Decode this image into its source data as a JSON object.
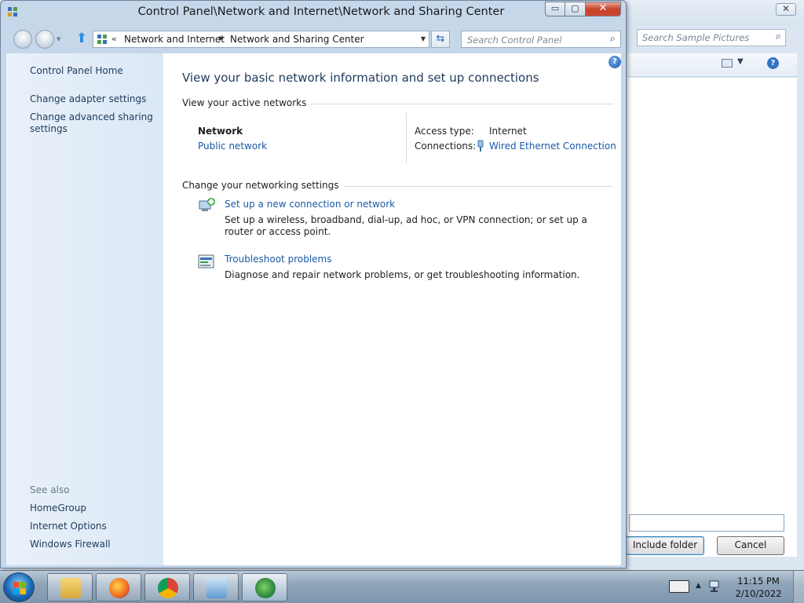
{
  "background_window": {
    "search_placeholder": "Search Sample Pictures",
    "include_button": "Include folder",
    "cancel_button": "Cancel",
    "close_label": "✕"
  },
  "window": {
    "title": "Control Panel\\Network and Internet\\Network and Sharing Center",
    "minimize": "▭",
    "maximize": "▢",
    "close": "✕"
  },
  "address_bar": {
    "chevron": "«",
    "crumbs": [
      "Network and Internet",
      "Network and Sharing Center"
    ],
    "separator": "▶",
    "dropdown": "▼"
  },
  "search": {
    "placeholder": "Search Control Panel"
  },
  "sidebar": {
    "home": "Control Panel Home",
    "items": [
      "Change adapter settings",
      "Change advanced sharing settings"
    ],
    "see_also_label": "See also",
    "see_also": [
      "HomeGroup",
      "Internet Options",
      "Windows Firewall"
    ]
  },
  "content": {
    "heading": "View your basic network information and set up connections",
    "active_networks_label": "View your active networks",
    "network": {
      "name": "Network",
      "type": "Public network",
      "access_type_label": "Access type:",
      "access_type_value": "Internet",
      "connections_label": "Connections:",
      "connections_value": "Wired Ethernet Connection"
    },
    "change_settings_label": "Change your networking settings",
    "tasks": [
      {
        "title": "Set up a new connection or network",
        "description": "Set up a wireless, broadband, dial-up, ad hoc, or VPN connection; or set up a router or access point.",
        "icon": "network-setup-icon"
      },
      {
        "title": "Troubleshoot problems",
        "description": "Diagnose and repair network problems, or get troubleshooting information.",
        "icon": "troubleshoot-icon"
      }
    ]
  },
  "taskbar": {
    "apps": [
      "explorer-icon",
      "firefox-icon",
      "chrome-icon",
      "control-panel-icon",
      "network-sharing-icon"
    ],
    "time": "11:15 PM",
    "date": "2/10/2022"
  },
  "colors": {
    "link": "#1a5aa6",
    "heading": "#1e395b",
    "sidebar_bg": "#dbe8f6",
    "close_red": "#c7432a"
  }
}
